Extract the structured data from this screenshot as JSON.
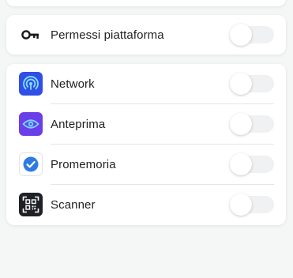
{
  "permissions": {
    "label": "Permessi piattaforma",
    "icon": "key-icon",
    "enabled": false
  },
  "items": [
    {
      "label": "Network",
      "icon": "network-icon",
      "icon_color": "#2f4fe6",
      "enabled": false
    },
    {
      "label": "Anteprima",
      "icon": "eye-icon",
      "icon_color": "#6a3ee8",
      "enabled": false
    },
    {
      "label": "Promemoria",
      "icon": "check-circle-icon",
      "icon_color": "#2f7be6",
      "enabled": false
    },
    {
      "label": "Scanner",
      "icon": "qr-scanner-icon",
      "icon_color": "#1f2127",
      "enabled": false
    }
  ]
}
